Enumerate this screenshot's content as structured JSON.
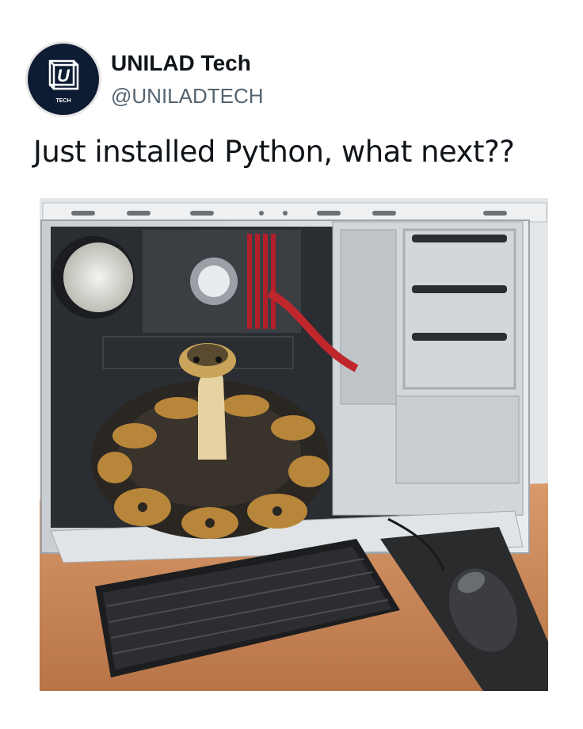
{
  "author": {
    "display_name": "UNILAD Tech",
    "handle": "@UNILADTECH",
    "avatar_logo_letter": "U",
    "avatar_logo_sub": "TECH"
  },
  "tweet": {
    "text": "Just installed Python, what next??"
  },
  "media": {
    "icon": "photo-snake-in-pc-case",
    "colors": {
      "case": "#d9dde0",
      "desk": "#c8875a",
      "snake_body": "#2a2622",
      "snake_pattern": "#b8863a"
    }
  }
}
